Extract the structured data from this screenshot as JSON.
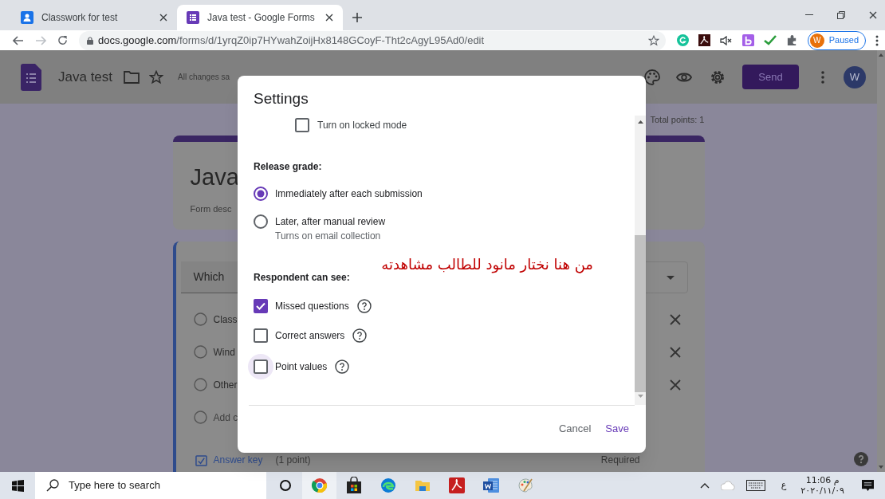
{
  "browser": {
    "tabs": [
      {
        "title": "Classwork for test",
        "kind": "classroom",
        "selected": false
      },
      {
        "title": "Java test - Google Forms",
        "kind": "forms",
        "selected": true
      }
    ],
    "url_host": "docs.google.com",
    "url_path": "/forms/d/1yrqZ0ip7HYwahZoijHx8148GCoyF-Tht2cAgyL95Ad0/edit",
    "profile": {
      "initial": "W",
      "status": "Paused"
    }
  },
  "forms_header": {
    "title": "Java test",
    "save_status": "All changes sa",
    "send": "Send",
    "avatar": "W",
    "total_points": "Total points: 1"
  },
  "title_card": {
    "title": "Java",
    "description": "Form desc"
  },
  "question_card": {
    "question": "Which",
    "options": [
      "Class",
      "Wind",
      "Other"
    ],
    "add_option": "Add c",
    "answer_key": "Answer key",
    "points": "(1 point)",
    "required": "Required"
  },
  "dialog": {
    "title": "Settings",
    "locked_mode": {
      "label": "Turn on locked mode",
      "checked": false
    },
    "release_grade": {
      "heading": "Release grade:",
      "options": [
        {
          "label": "Immediately after each submission",
          "selected": true
        },
        {
          "label": "Later, after manual review",
          "note": "Turns on email collection",
          "selected": false
        }
      ]
    },
    "respondent": {
      "heading": "Respondent can see:",
      "options": [
        {
          "label": "Missed questions",
          "checked": true,
          "focused": false
        },
        {
          "label": "Correct answers",
          "checked": false,
          "focused": false
        },
        {
          "label": "Point values",
          "checked": false,
          "focused": true
        }
      ]
    },
    "cancel": "Cancel",
    "save": "Save"
  },
  "annotation": "من هنا نختار مانود للطالب مشاهدته",
  "taskbar": {
    "search_placeholder": "Type here to search",
    "language": "ع",
    "time": "11:06 م",
    "date": "٢٠٢٠/١١/٠٩"
  }
}
